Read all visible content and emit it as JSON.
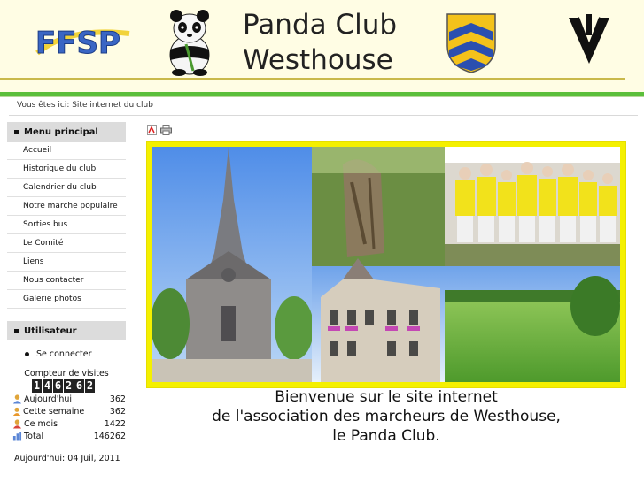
{
  "header": {
    "title_line1": "Panda Club",
    "title_line2": "Westhouse",
    "logo_ffsp_text": "FFSP"
  },
  "breadcrumb": "Vous êtes ici:  Site internet du club",
  "sidebar": {
    "main_menu_title": "Menu principal",
    "items": [
      {
        "label": "Accueil"
      },
      {
        "label": "Historique du club"
      },
      {
        "label": "Calendrier du club"
      },
      {
        "label": "Notre marche populaire"
      },
      {
        "label": "Sorties bus"
      },
      {
        "label": "Le Comité"
      },
      {
        "label": "Liens"
      },
      {
        "label": "Nous contacter"
      },
      {
        "label": "Galerie photos"
      }
    ],
    "user_title": "Utilisateur",
    "login_label": "Se connecter"
  },
  "counter": {
    "title": "Compteur de visites",
    "digits": [
      "1",
      "4",
      "6",
      "2",
      "6",
      "2"
    ],
    "rows": [
      {
        "icon": "user-today-icon",
        "label": "Aujourd'hui",
        "value": "362"
      },
      {
        "icon": "user-week-icon",
        "label": "Cette semaine",
        "value": "362"
      },
      {
        "icon": "user-month-icon",
        "label": "Ce mois",
        "value": "1422"
      },
      {
        "icon": "total-chart-icon",
        "label": "Total",
        "value": "146262"
      }
    ],
    "today": "Aujourd'hui: 04 Juil, 2011"
  },
  "content": {
    "icons": [
      "pdf-icon",
      "print-icon"
    ],
    "welcome_line1": "Bienvenue sur le site internet",
    "welcome_line2": "de l'association des marcheurs de Westhouse,",
    "welcome_line3": "le Panda Club."
  },
  "colors": {
    "header_bg": "#fffde4",
    "green_bar": "#5bbf3a",
    "frame_yellow": "#f4f000",
    "menu_title_bg": "#dcdcdc"
  }
}
